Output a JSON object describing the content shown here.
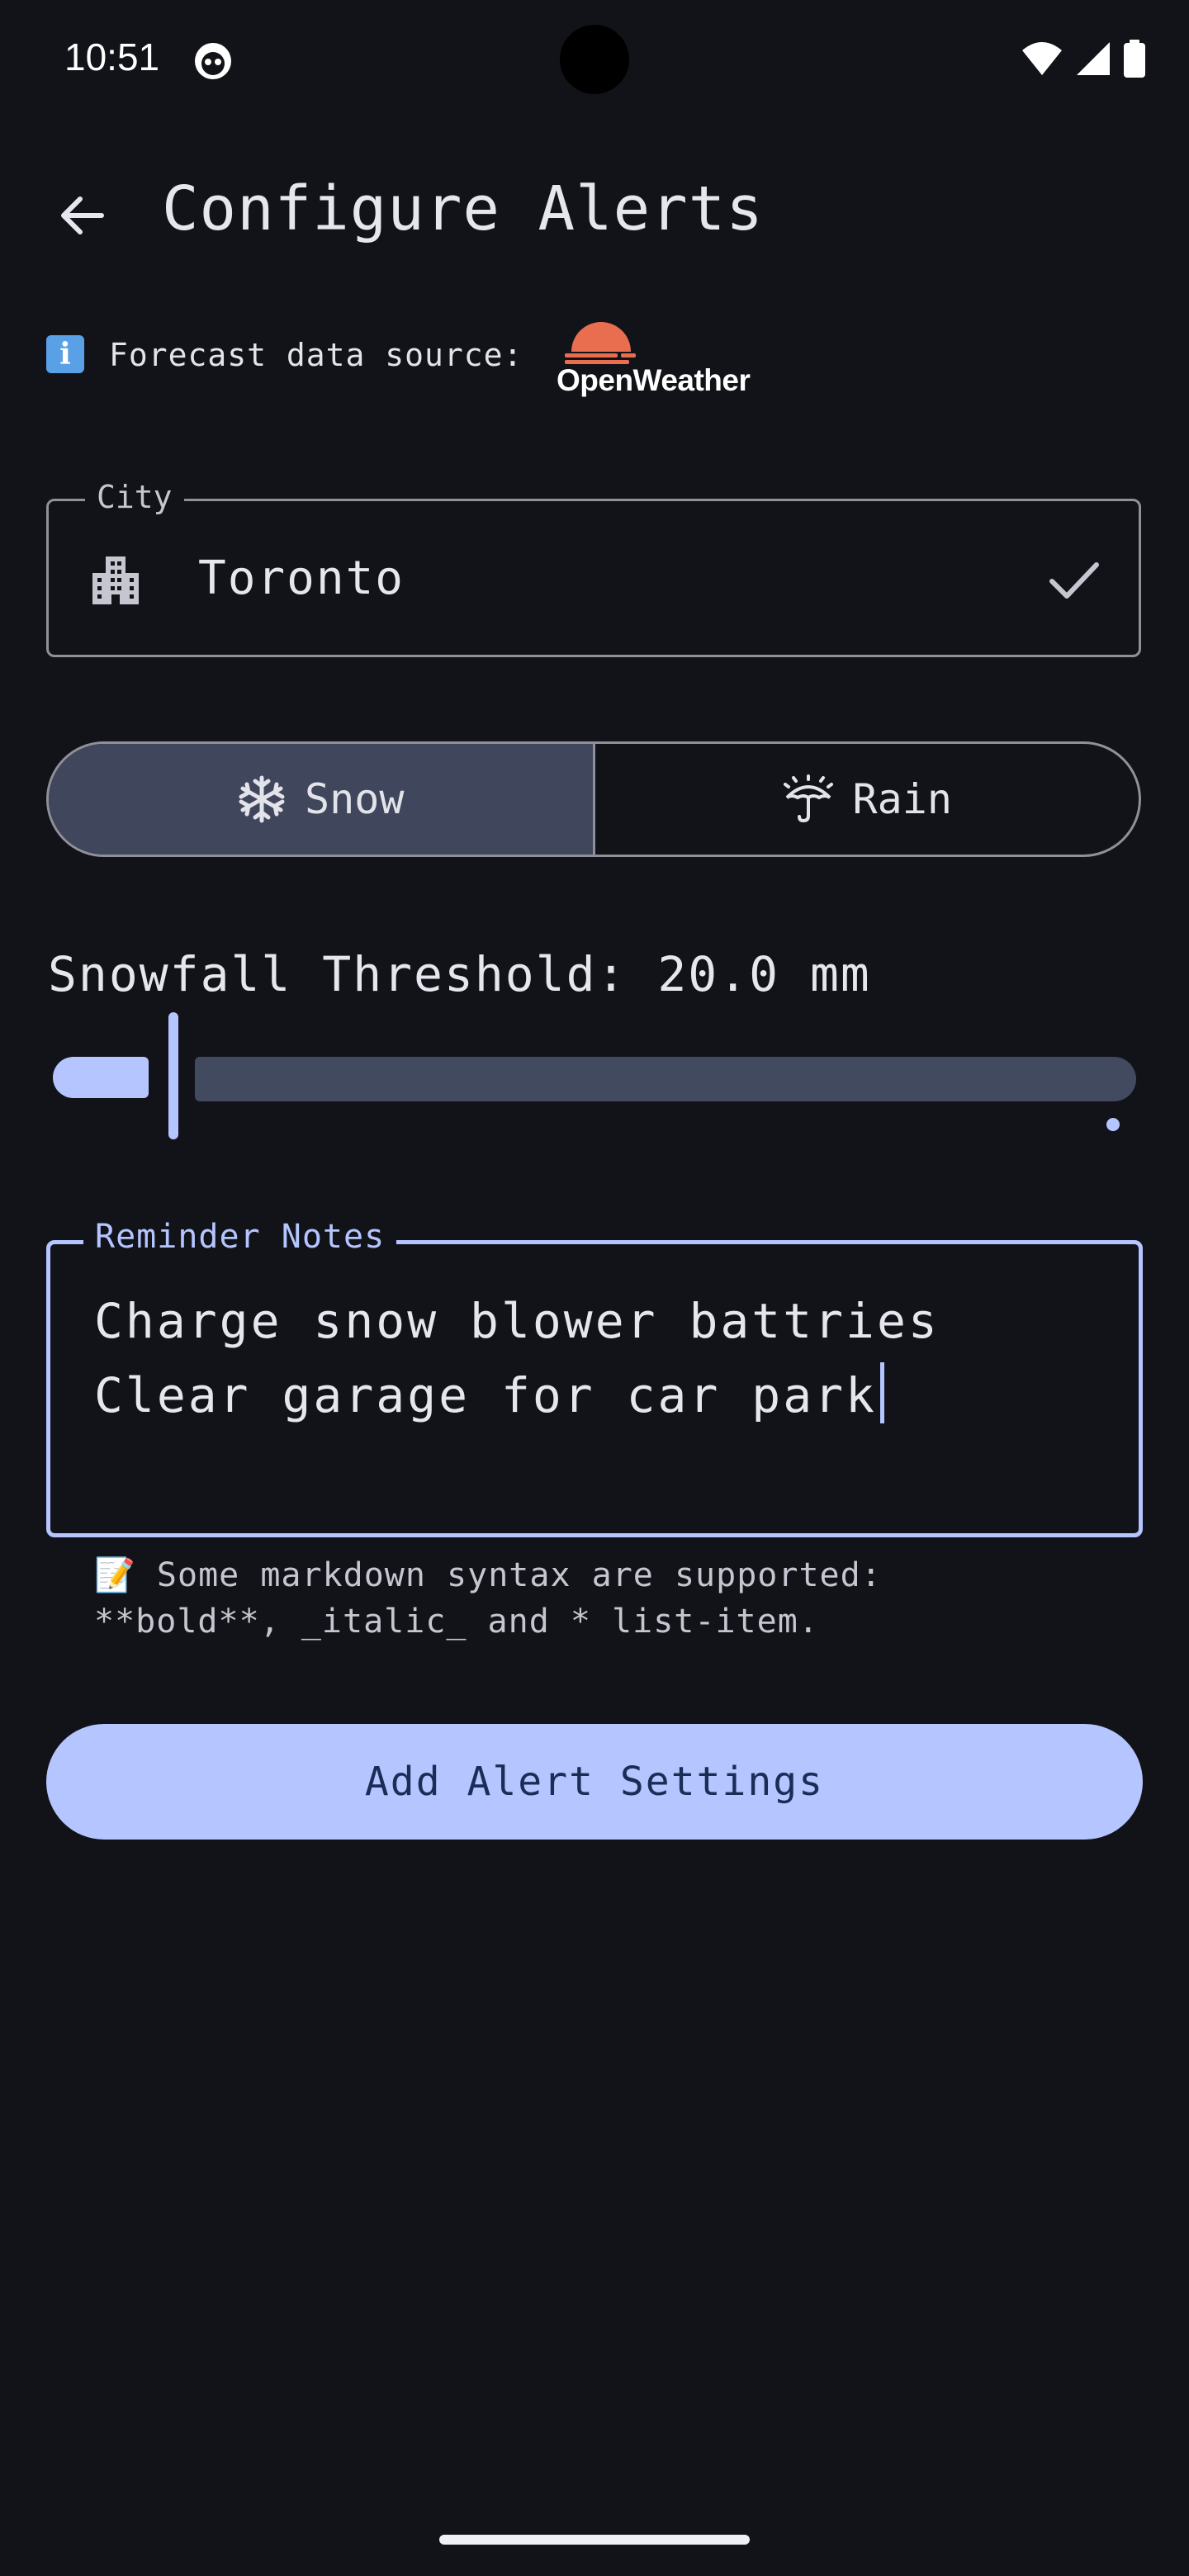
{
  "status_bar": {
    "time": "10:51"
  },
  "header": {
    "title": "Configure Alerts"
  },
  "source": {
    "label": "Forecast data source:",
    "logo_text": "OpenWeather",
    "logo_color": "#e96e50"
  },
  "city": {
    "label": "City",
    "value": "Toronto"
  },
  "segments": {
    "snow": "Snow",
    "rain": "Rain",
    "selected": "Snow"
  },
  "slider": {
    "label": "Snowfall Threshold: 20.0 mm",
    "value_fraction": 0.08
  },
  "notes": {
    "label": "Reminder Notes",
    "line1": "Charge snow blower battries",
    "line2": "Clear garage for car park"
  },
  "hint": {
    "line1": "Some markdown syntax are supported:",
    "line2": "**bold**, _italic_ and * list-item."
  },
  "actions": {
    "add_label": "Add Alert Settings"
  },
  "colors": {
    "background": "#121318",
    "accent": "#b4c5ff",
    "selected_segment": "#40475c"
  }
}
